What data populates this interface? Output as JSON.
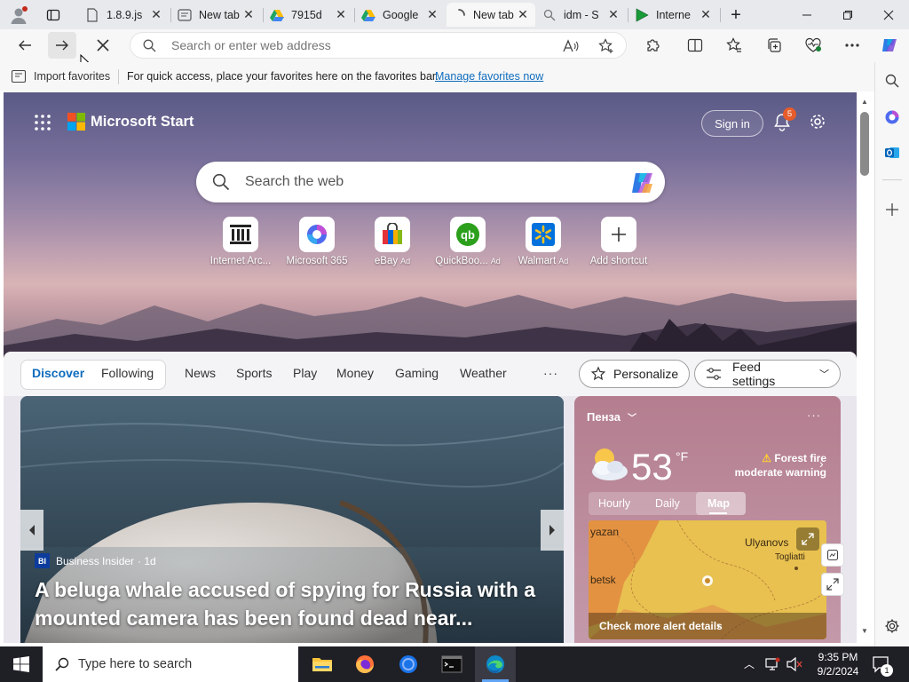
{
  "tabs": [
    {
      "label": "1.8.9.js",
      "icon": "file-icon"
    },
    {
      "label": "New tab",
      "icon": "newtab-page-icon"
    },
    {
      "label": "7915d",
      "icon": "google-drive-icon"
    },
    {
      "label": "Google",
      "icon": "google-drive-icon"
    },
    {
      "label": "New tab",
      "icon": "loading-spinner-icon"
    },
    {
      "label": "idm - S",
      "icon": "search-icon"
    },
    {
      "label": "Interne",
      "icon": "play-icon"
    }
  ],
  "address_bar": {
    "placeholder": "Search or enter web address"
  },
  "favorites_bar": {
    "import_label": "Import favorites",
    "message": "For quick access, place your favorites here on the favorites bar.",
    "manage_link": "Manage favorites now"
  },
  "msn": {
    "logo_text": "Microsoft Start",
    "sign_in": "Sign in",
    "notification_count": "5",
    "search_placeholder": "Search the web",
    "shortcuts": [
      {
        "label": "Internet Arc...",
        "ad": "",
        "icon": "archive-icon"
      },
      {
        "label": "Microsoft 365",
        "ad": "",
        "icon": "m365-icon"
      },
      {
        "label": "eBay",
        "ad": "Ad",
        "icon": "ebay-bag-icon"
      },
      {
        "label": "QuickBoo...",
        "ad": "Ad",
        "icon": "quickbooks-icon"
      },
      {
        "label": "Walmart",
        "ad": "Ad",
        "icon": "walmart-icon"
      },
      {
        "label": "Add shortcut",
        "ad": "",
        "icon": "plus-icon"
      }
    ]
  },
  "feed_nav": {
    "items": [
      "Discover",
      "Following",
      "News",
      "Sports",
      "Play",
      "Money",
      "Gaming",
      "Weather"
    ],
    "more": "···",
    "personalize": "Personalize",
    "feed_settings": "Feed settings"
  },
  "headline": {
    "source_badge": "BI",
    "source": "Business Insider",
    "age": "· 1d",
    "title": "A beluga whale accused of spying for Russia with a mounted camera has been found dead near..."
  },
  "weather": {
    "location": "Пенза",
    "temperature": "53",
    "unit": "°F",
    "alert_line1": "Forest fire",
    "alert_line2": "moderate warning",
    "tabs": [
      "Hourly",
      "Daily",
      "Map"
    ],
    "active_tab": "Map",
    "map_labels": [
      "yazan",
      "Ulyanovs",
      "Togliatti",
      "betsk"
    ],
    "cta": "Check more alert details"
  },
  "taskbar": {
    "search_placeholder": "Type here to search",
    "time": "9:35 PM",
    "date": "9/2/2024",
    "notification_count": "1"
  },
  "colors": {
    "accent": "#0f6cbd",
    "link": "#0f6cbd",
    "badge": "#e65c2b",
    "taskbar": "#1f1f26"
  }
}
